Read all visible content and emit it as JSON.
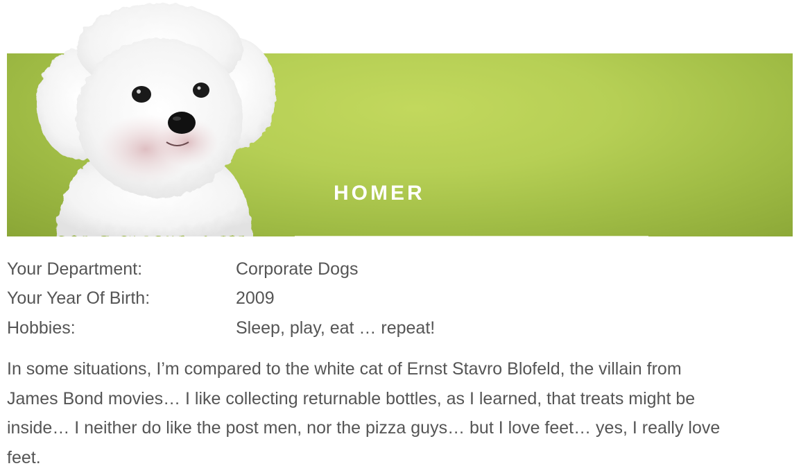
{
  "profile": {
    "name": "HOMER",
    "photo_icon": "white-bichon-dog-photo",
    "banner_color": "#b6cf55"
  },
  "details": [
    {
      "label": "Your Department:",
      "value": "Corporate Dogs"
    },
    {
      "label": "Your Year Of Birth:",
      "value": "2009"
    },
    {
      "label": "Hobbies:",
      "value": "Sleep, play, eat … repeat!"
    }
  ],
  "bio": {
    "lines": [
      "In some situations, I’m compared to the white cat of Ernst Stavro Blofeld, the villain from",
      "James Bond movies…  I like collecting returnable bottles, as I learned, that treats might be",
      "inside… I neither do like the post men, nor the pizza guys… but I love feet… yes, I really love",
      "feet."
    ]
  }
}
